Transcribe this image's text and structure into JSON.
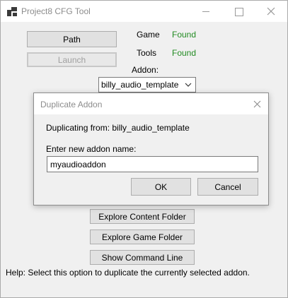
{
  "window": {
    "title": "Project8 CFG Tool"
  },
  "main": {
    "path_button": "Path",
    "launch_button": "Launch",
    "game_label": "Game",
    "game_status": "Found",
    "tools_label": "Tools",
    "tools_status": "Found",
    "addon_label": "Addon:",
    "addon_selected": "billy_audio_template",
    "explore_content_button": "Explore Content Folder",
    "explore_game_button": "Explore Game Folder",
    "show_command_button": "Show Command Line",
    "help_text": "Help: Select this option to duplicate the currently selected addon."
  },
  "dialog": {
    "title": "Duplicate Addon",
    "duplicating_text": "Duplicating from: billy_audio_template",
    "name_label": "Enter new addon name:",
    "name_value": "myaudioaddon",
    "ok_button": "OK",
    "cancel_button": "Cancel"
  },
  "colors": {
    "found": "#228b22",
    "disabled_text": "#a0a0a0"
  }
}
